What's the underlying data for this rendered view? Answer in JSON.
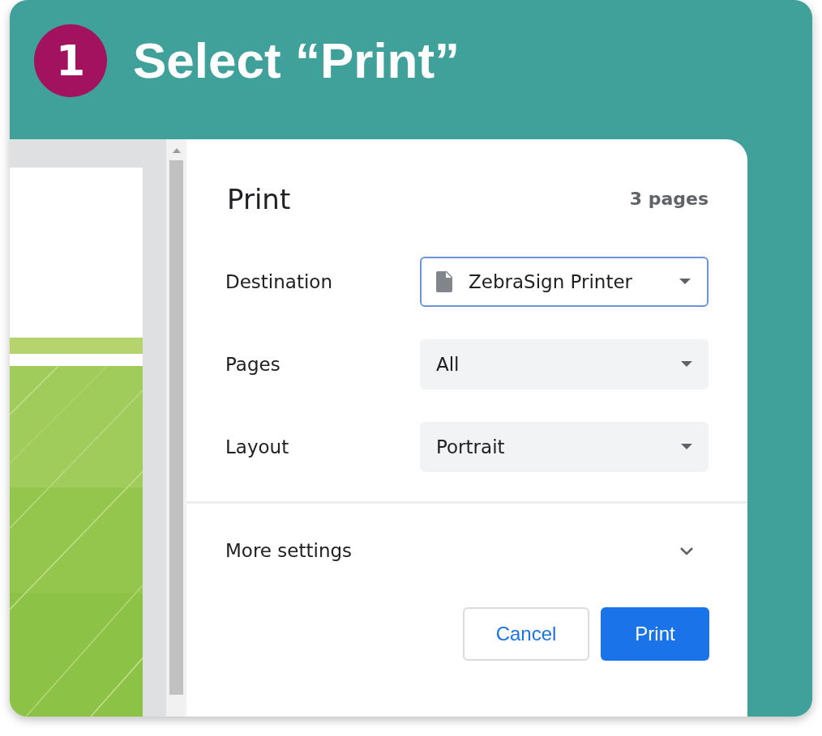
{
  "step": {
    "number": "1",
    "title": "Select “Print”"
  },
  "dialog": {
    "title": "Print",
    "page_count": "3 pages",
    "fields": [
      {
        "label": "Destination",
        "value": "ZebraSign Printer",
        "kind": "destination",
        "focused": true
      },
      {
        "label": "Pages",
        "value": "All",
        "kind": "select",
        "focused": false
      },
      {
        "label": "Layout",
        "value": "Portrait",
        "kind": "select",
        "focused": false
      }
    ],
    "more_settings": {
      "label": "More settings",
      "expanded": false
    },
    "buttons": [
      {
        "label": "Cancel",
        "kind": "secondary"
      },
      {
        "label": "Print",
        "kind": "primary"
      }
    ]
  }
}
